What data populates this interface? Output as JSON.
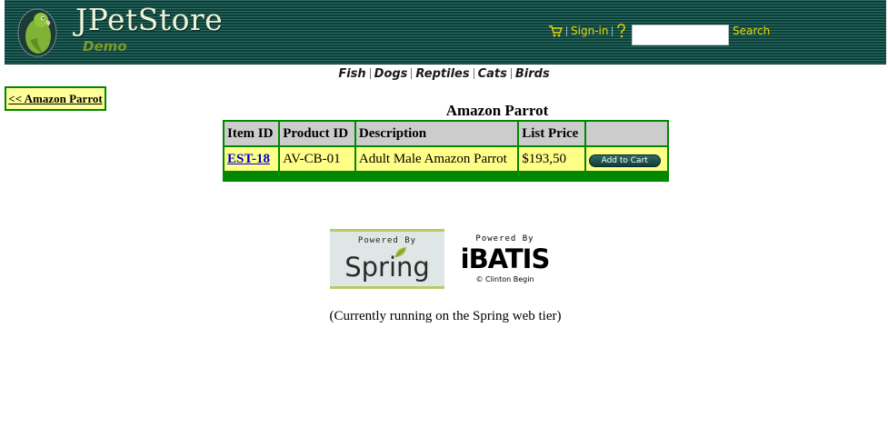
{
  "header": {
    "logo_title": "JPetStore",
    "logo_subtitle": "Demo",
    "cart_icon": "shopping-cart-icon",
    "help_icon": "help-icon",
    "sign_in_label": "Sign-in",
    "search": {
      "value": "",
      "placeholder": "",
      "button_label": "Search"
    },
    "menu_color": "#e8d800"
  },
  "quicklinks": [
    "Fish",
    "Dogs",
    "Reptiles",
    "Cats",
    "Birds"
  ],
  "back_link": "<< Amazon Parrot",
  "product": {
    "title": "Amazon Parrot",
    "columns": [
      "Item ID",
      "Product ID",
      "Description",
      "List Price",
      ""
    ],
    "rows": [
      {
        "item_id": "EST-18",
        "product_id": "AV-CB-01",
        "description": "Adult Male Amazon Parrot",
        "list_price": "$193,50",
        "action_label": "Add to Cart"
      }
    ]
  },
  "footer": {
    "spring_powered_by": "Powered By",
    "spring_name": "Spring",
    "ibatis_powered_by": "Powered By",
    "ibatis_name": "iBATIS",
    "ibatis_copyright": "© Clinton Begin",
    "running_text": "(Currently running on the Spring web tier)"
  },
  "colors": {
    "table_border": "#008800",
    "header_cell": "#cccccc",
    "data_cell": "#ffff88",
    "back_box": "#ffff99"
  }
}
